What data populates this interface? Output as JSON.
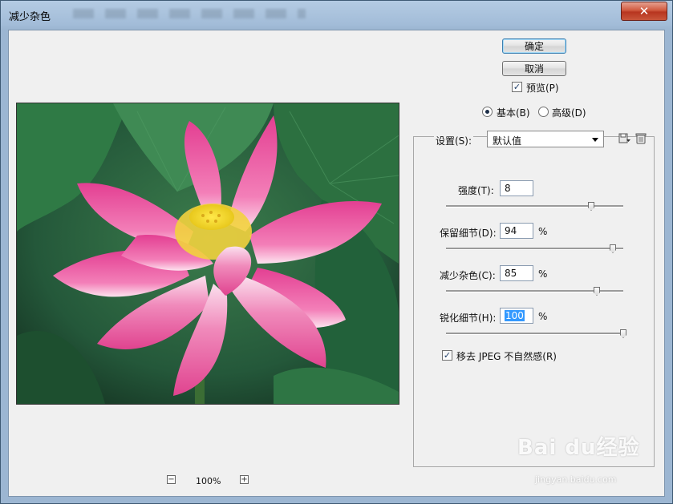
{
  "window": {
    "title": "减少杂色",
    "close_glyph": "✕"
  },
  "buttons": {
    "ok": "确定",
    "cancel": "取消"
  },
  "preview": {
    "label": "预览(P)",
    "checked": true,
    "image": "pink-lotus-flower-photo"
  },
  "mode": {
    "basic": "基本(B)",
    "advanced": "高级(D)",
    "selected": "basic"
  },
  "settings": {
    "label": "设置(S):",
    "value": "默认值",
    "save_icon": "save-settings-icon",
    "delete_icon": "trash-icon"
  },
  "params": {
    "strength": {
      "label": "强度(T):",
      "value": "8",
      "max": 10
    },
    "preserve_details": {
      "label": "保留细节(D):",
      "value": "94",
      "unit": "%",
      "max": 100
    },
    "reduce_color_noise": {
      "label": "减少杂色(C):",
      "value": "85",
      "unit": "%",
      "max": 100
    },
    "sharpen_details": {
      "label": "锐化细节(H):",
      "value": "100",
      "unit": "%",
      "max": 100
    }
  },
  "jpeg": {
    "label": "移去 JPEG 不自然感(R)",
    "checked": true
  },
  "zoom": {
    "level": "100%",
    "minus": "−",
    "plus": "+"
  },
  "watermark": {
    "brand": "Bai du经验",
    "url": "jingyan.baidu.com"
  },
  "colors": {
    "title_bar": "#a2bcd8",
    "close_button": "#c9553a",
    "dialog_bg": "#f0f0f0",
    "selection": "#3399ff"
  }
}
